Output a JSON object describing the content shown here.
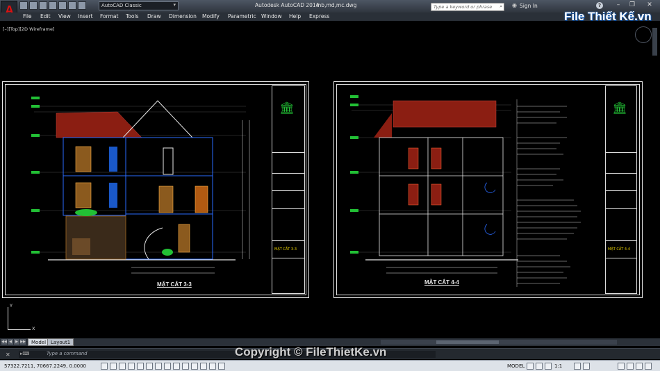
{
  "titlebar": {
    "app_title": "Autodesk AutoCAD 2014",
    "file_name": "mb,md,mc.dwg",
    "workspace": "AutoCAD Classic",
    "search_placeholder": "Type a keyword or phrase",
    "sign_in": "Sign In",
    "help": "?",
    "minimize": "–",
    "restore": "❐",
    "close": "✕",
    "app_letter": "A"
  },
  "menu": {
    "items": [
      "File",
      "Edit",
      "View",
      "Insert",
      "Format",
      "Tools",
      "Draw",
      "Dimension",
      "Modify",
      "Parametric",
      "Window",
      "Help",
      "Express"
    ]
  },
  "viewport": {
    "label": "[–][Top][2D Wireframe]"
  },
  "drawings": {
    "left_caption": "MẶT CẮT 3-3",
    "right_caption": "MẶT CẮT 4-4",
    "left_tb_label": "MẶT CẮT 3-3",
    "right_tb_label": "MẶT CẮT 4-4"
  },
  "ucs": {
    "x": "X",
    "y": "Y"
  },
  "tabs": {
    "model": "Model",
    "layout1": "Layout1",
    "nav": [
      "◀◀",
      "◀",
      "▶",
      "▶▶"
    ]
  },
  "command": {
    "close": "✕",
    "placeholder": "Type a command"
  },
  "statusbar": {
    "coords": "57322.7211, 70667.2249, 0.0000",
    "model": "MODEL",
    "scale": "1:1"
  },
  "watermark": {
    "brand": "File Thiết Kế.vn",
    "copyright": "Copyright © FileThietKe.vn"
  },
  "colors": {
    "grid_lines": "#4a4a4a",
    "building_lines": "#2a6bff",
    "roof": "#8b1e12",
    "accent_green": "#22c035",
    "dim_text": "#e8e8e8"
  }
}
